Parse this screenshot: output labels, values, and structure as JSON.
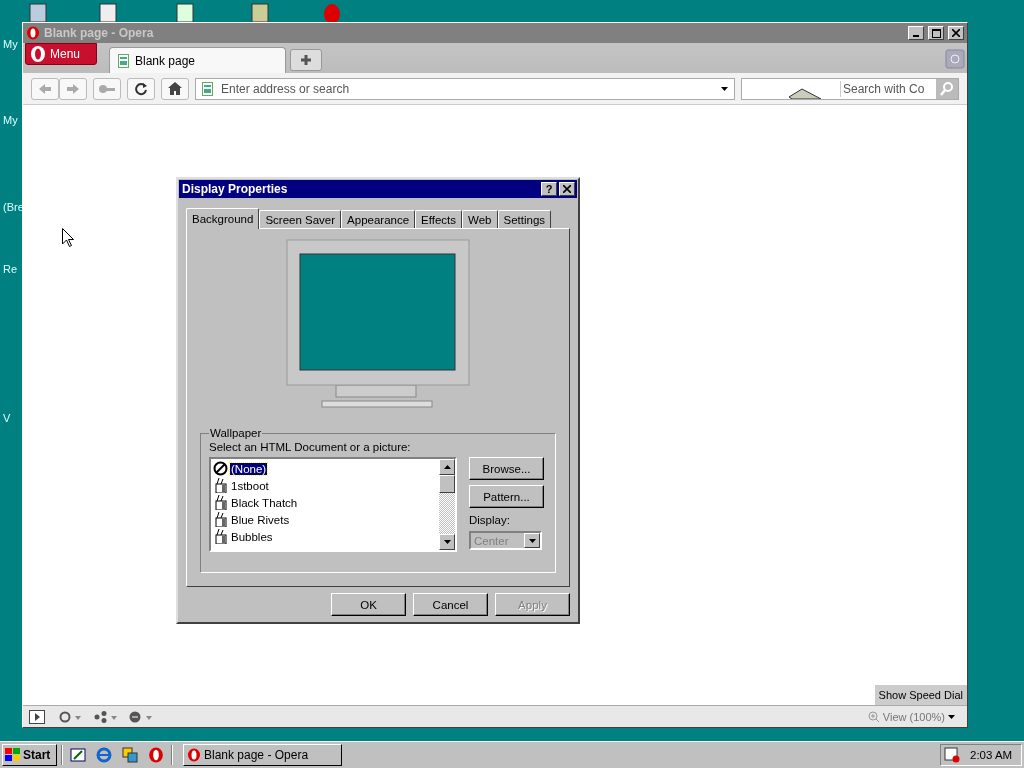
{
  "desktop": {
    "icon_labels": [
      "My",
      "My",
      "(Bre",
      "Re",
      "V"
    ]
  },
  "browser": {
    "title": "Blank page - Opera",
    "menu_button": "Menu",
    "tabs": [
      {
        "label": "Blank page",
        "selected": true
      }
    ],
    "address": {
      "placeholder": "Enter address or search"
    },
    "search": {
      "placeholder": "Search with Co"
    },
    "speed_dial_button": "Show Speed Dial",
    "zoom": "View (100%)"
  },
  "dialog": {
    "title": "Display Properties",
    "help": "?",
    "tabs": [
      {
        "label": "Background",
        "selected": true
      },
      {
        "label": "Screen Saver",
        "selected": false
      },
      {
        "label": "Appearance",
        "selected": false
      },
      {
        "label": "Effects",
        "selected": false
      },
      {
        "label": "Web",
        "selected": false
      },
      {
        "label": "Settings",
        "selected": false
      }
    ],
    "wallpaper": {
      "legend": "Wallpaper",
      "label": "Select an HTML Document or a picture:",
      "items": [
        {
          "label": "(None)",
          "kind": "none",
          "selected": true
        },
        {
          "label": "1stboot",
          "kind": "picture",
          "selected": false
        },
        {
          "label": "Black Thatch",
          "kind": "picture",
          "selected": false
        },
        {
          "label": "Blue Rivets",
          "kind": "picture",
          "selected": false
        },
        {
          "label": "Bubbles",
          "kind": "picture",
          "selected": false
        }
      ],
      "side_buttons": [
        "Browse...",
        "Pattern..."
      ],
      "display_label": "Display:",
      "display": {
        "value": "Center",
        "disabled": true
      }
    },
    "buttons": [
      {
        "label": "OK",
        "disabled": false
      },
      {
        "label": "Cancel",
        "disabled": false
      },
      {
        "label": "Apply",
        "disabled": true
      }
    ]
  },
  "taskbar": {
    "start": "Start",
    "tasks": [
      {
        "label": "Blank page - Opera",
        "selected": false
      }
    ],
    "clock": "2:03 AM"
  }
}
